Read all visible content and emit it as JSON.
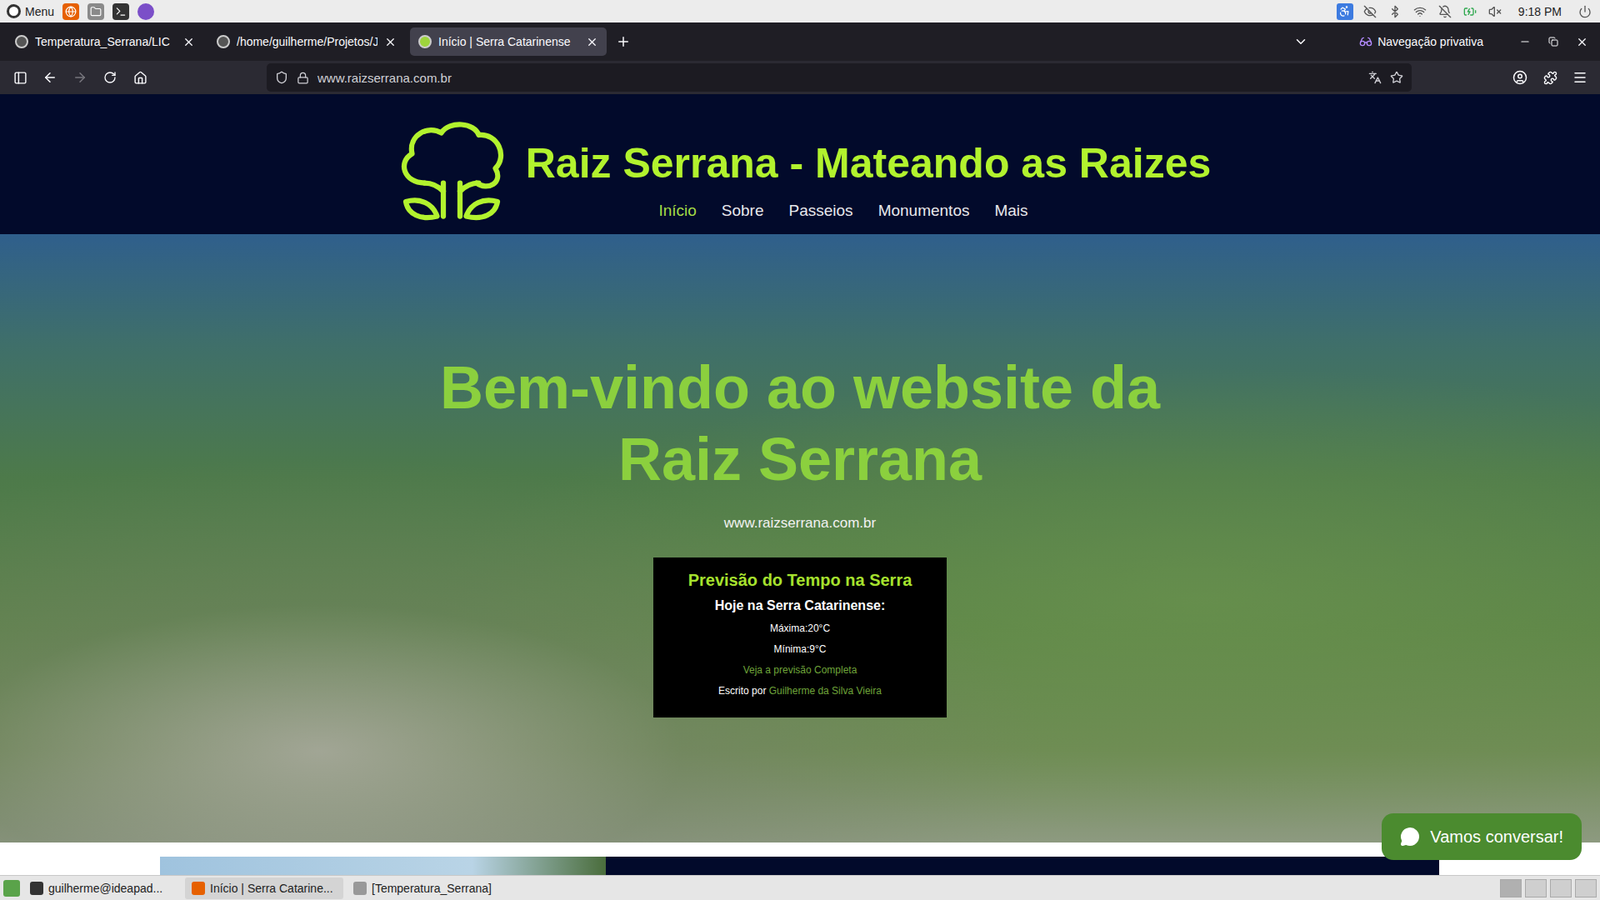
{
  "system_panel": {
    "menu": "Menu",
    "clock": "9:18 PM"
  },
  "browser": {
    "tabs": [
      {
        "label": "Temperatura_Serrana/LIC",
        "selected": false
      },
      {
        "label": "/home/guilherme/Projetos/J",
        "selected": false
      },
      {
        "label": "Início | Serra Catarinense",
        "selected": true
      }
    ],
    "private_label": "Navegação privativa",
    "url": "www.raizserrana.com.br"
  },
  "site": {
    "title": "Raiz Serrana - Mateando as Raizes",
    "nav": [
      {
        "label": "Início",
        "selected": true
      },
      {
        "label": "Sobre",
        "selected": false
      },
      {
        "label": "Passeios",
        "selected": false
      },
      {
        "label": "Monumentos",
        "selected": false
      },
      {
        "label": "Mais",
        "selected": false
      }
    ],
    "hero": {
      "heading": "Bem-vindo ao website da Raiz Serrana",
      "subtitle": "www.raizserrana.com.br"
    },
    "weather": {
      "title": "Previsão do Tempo na Serra",
      "subtitle": "Hoje na Serra Catarinense:",
      "max": "Máxima:20°C",
      "min": "Mínima:9°C",
      "link": "Veja a previsão Completa",
      "byline_prefix": "Escrito por",
      "author": "Guilherme da Silva Vieira"
    },
    "chat": {
      "label": "Vamos conversar!"
    }
  },
  "taskbar": {
    "items": [
      {
        "label": "guilherme@ideapad...",
        "selected": false
      },
      {
        "label": "Início | Serra Catarine...",
        "selected": true
      },
      {
        "label": "[Temperatura_Serrana]",
        "selected": false
      }
    ]
  }
}
